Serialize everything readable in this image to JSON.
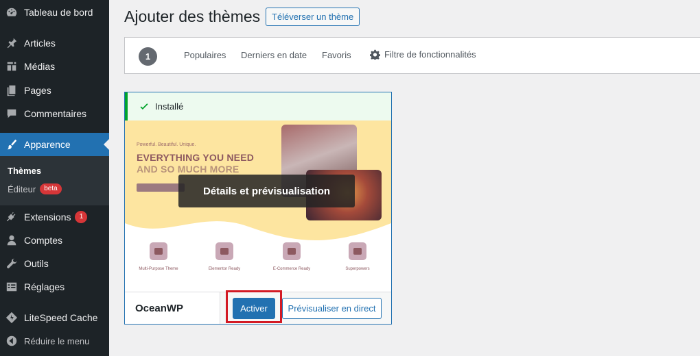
{
  "sidebar": {
    "items": [
      {
        "label": "Tableau de bord",
        "icon": "dashboard-icon"
      },
      {
        "label": "Articles",
        "icon": "pin-icon"
      },
      {
        "label": "Médias",
        "icon": "media-icon"
      },
      {
        "label": "Pages",
        "icon": "pages-icon"
      },
      {
        "label": "Commentaires",
        "icon": "comments-icon"
      },
      {
        "label": "Apparence",
        "icon": "brush-icon"
      },
      {
        "label": "Extensions",
        "icon": "plugin-icon",
        "count": "1"
      },
      {
        "label": "Comptes",
        "icon": "user-icon"
      },
      {
        "label": "Outils",
        "icon": "wrench-icon"
      },
      {
        "label": "Réglages",
        "icon": "settings-icon"
      },
      {
        "label": "LiteSpeed Cache",
        "icon": "litespeed-icon"
      },
      {
        "label": "Réduire le menu",
        "icon": "collapse-icon"
      }
    ],
    "submenu": {
      "themes": "Thèmes",
      "editor": "Éditeur",
      "editor_badge": "beta"
    }
  },
  "header": {
    "title": "Ajouter des thèmes",
    "upload_button": "Téléverser un thème"
  },
  "filter_bar": {
    "count": "1",
    "links": [
      "Populaires",
      "Derniers en date",
      "Favoris"
    ],
    "feature_filter": "Filtre de fonctionnalités"
  },
  "theme_card": {
    "installed_notice": "Installé",
    "overlay_label": "Détails et prévisualisation",
    "name": "OceanWP",
    "activate_label": "Activer",
    "preview_label": "Prévisualiser en direct",
    "screenshot": {
      "tagline": "Powerful. Beautiful. Unique.",
      "headline_1": "EVERYTHING YOU NEED",
      "headline_2": "AND SO MUCH MORE",
      "features": [
        "Multi-Purpose Theme",
        "Elementor Ready",
        "E-Commerce Ready",
        "Superpowers"
      ]
    }
  },
  "colors": {
    "sidebar_bg": "#1d2327",
    "accent": "#2271b1",
    "badge": "#d63638",
    "success": "#00a32a",
    "highlight": "#d31a24"
  }
}
